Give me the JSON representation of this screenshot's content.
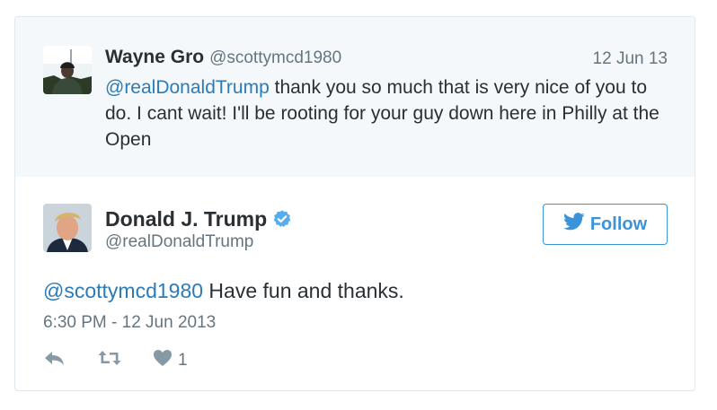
{
  "reply": {
    "name": "Wayne Gro",
    "handle": "@scottymcd1980",
    "date": "12 Jun 13",
    "mention": "@realDonaldTrump",
    "text": " thank you so much that is very nice of you to do. I cant wait! I'll be rooting for your guy down here in Philly at the Open"
  },
  "tweet": {
    "name": "Donald J. Trump",
    "handle": "@realDonaldTrump",
    "follow_label": "Follow",
    "mention": "@scottymcd1980",
    "text": " Have fun and thanks.",
    "timestamp": "6:30 PM - 12 Jun 2013",
    "like_count": "1"
  },
  "colors": {
    "link": "#2b7bb9",
    "follow": "#3b94d9",
    "muted": "#66757f",
    "reply_bg": "#f5f8fa",
    "verified": "#55acee"
  },
  "icons": [
    "reply-icon",
    "retweet-icon",
    "heart-icon",
    "bird-icon",
    "verified-badge-icon"
  ]
}
